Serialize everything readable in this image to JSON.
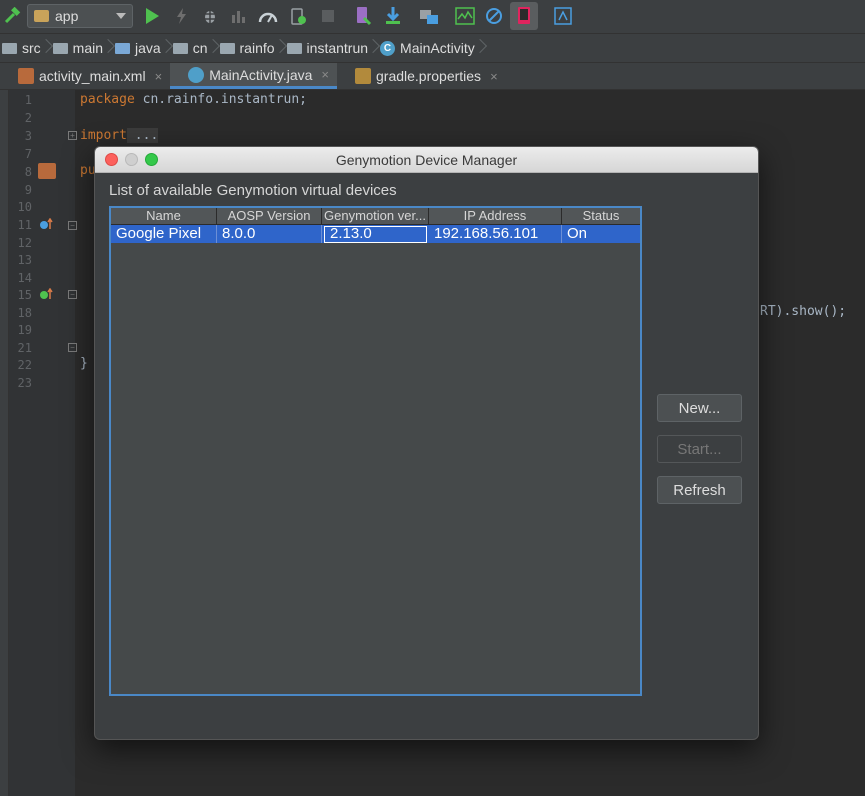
{
  "toolbar": {
    "run_config": "app",
    "icons": [
      "hammer-icon",
      "run-icon",
      "apply-changes-icon",
      "debug-icon",
      "coverage-icon",
      "profiler-icon",
      "attach-debugger-icon",
      "stop-icon",
      "avd-manager-icon",
      "sdk-manager-icon",
      "project-structure-icon",
      "android-profiler-icon",
      "no-entry-icon",
      "genymotion-icon",
      "layout-inspector-icon"
    ]
  },
  "breadcrumb": [
    "src",
    "main",
    "java",
    "cn",
    "rainfo",
    "instantrun",
    "MainActivity"
  ],
  "tabs": [
    {
      "label": "activity_main.xml",
      "close": "×"
    },
    {
      "label": "MainActivity.java",
      "close": "×"
    },
    {
      "label": "gradle.properties",
      "close": "×"
    }
  ],
  "editor": {
    "line_numbers": [
      "1",
      "2",
      "3",
      "7",
      "8",
      "9",
      "10",
      "11",
      "12",
      "13",
      "14",
      "15",
      "18",
      "19",
      "21",
      "22",
      "23"
    ],
    "line1_kw": "package",
    "line1_rest": " cn.rainfo.instantrun;",
    "line3_kw": "import",
    "line3_rest": " ...",
    "line8_kw": "pu",
    "line18_right": "RT).show();",
    "line22": "}"
  },
  "dialog": {
    "title": "Genymotion Device Manager",
    "list_title": "List of available Genymotion virtual devices",
    "columns": [
      "Name",
      "AOSP Version",
      "Genymotion ver...",
      "IP Address",
      "Status"
    ],
    "rows": [
      {
        "name": "Google Pixel",
        "aosp": "8.0.0",
        "genymotion": "2.13.0",
        "ip": "192.168.56.101",
        "status": "On"
      }
    ],
    "buttons": {
      "new": "New...",
      "start": "Start...",
      "refresh": "Refresh"
    }
  },
  "colors": {
    "selection": "#2f65ca",
    "focus_border": "#4a88c7",
    "keyword": "#cc7832",
    "run_green": "#4fc14f"
  }
}
